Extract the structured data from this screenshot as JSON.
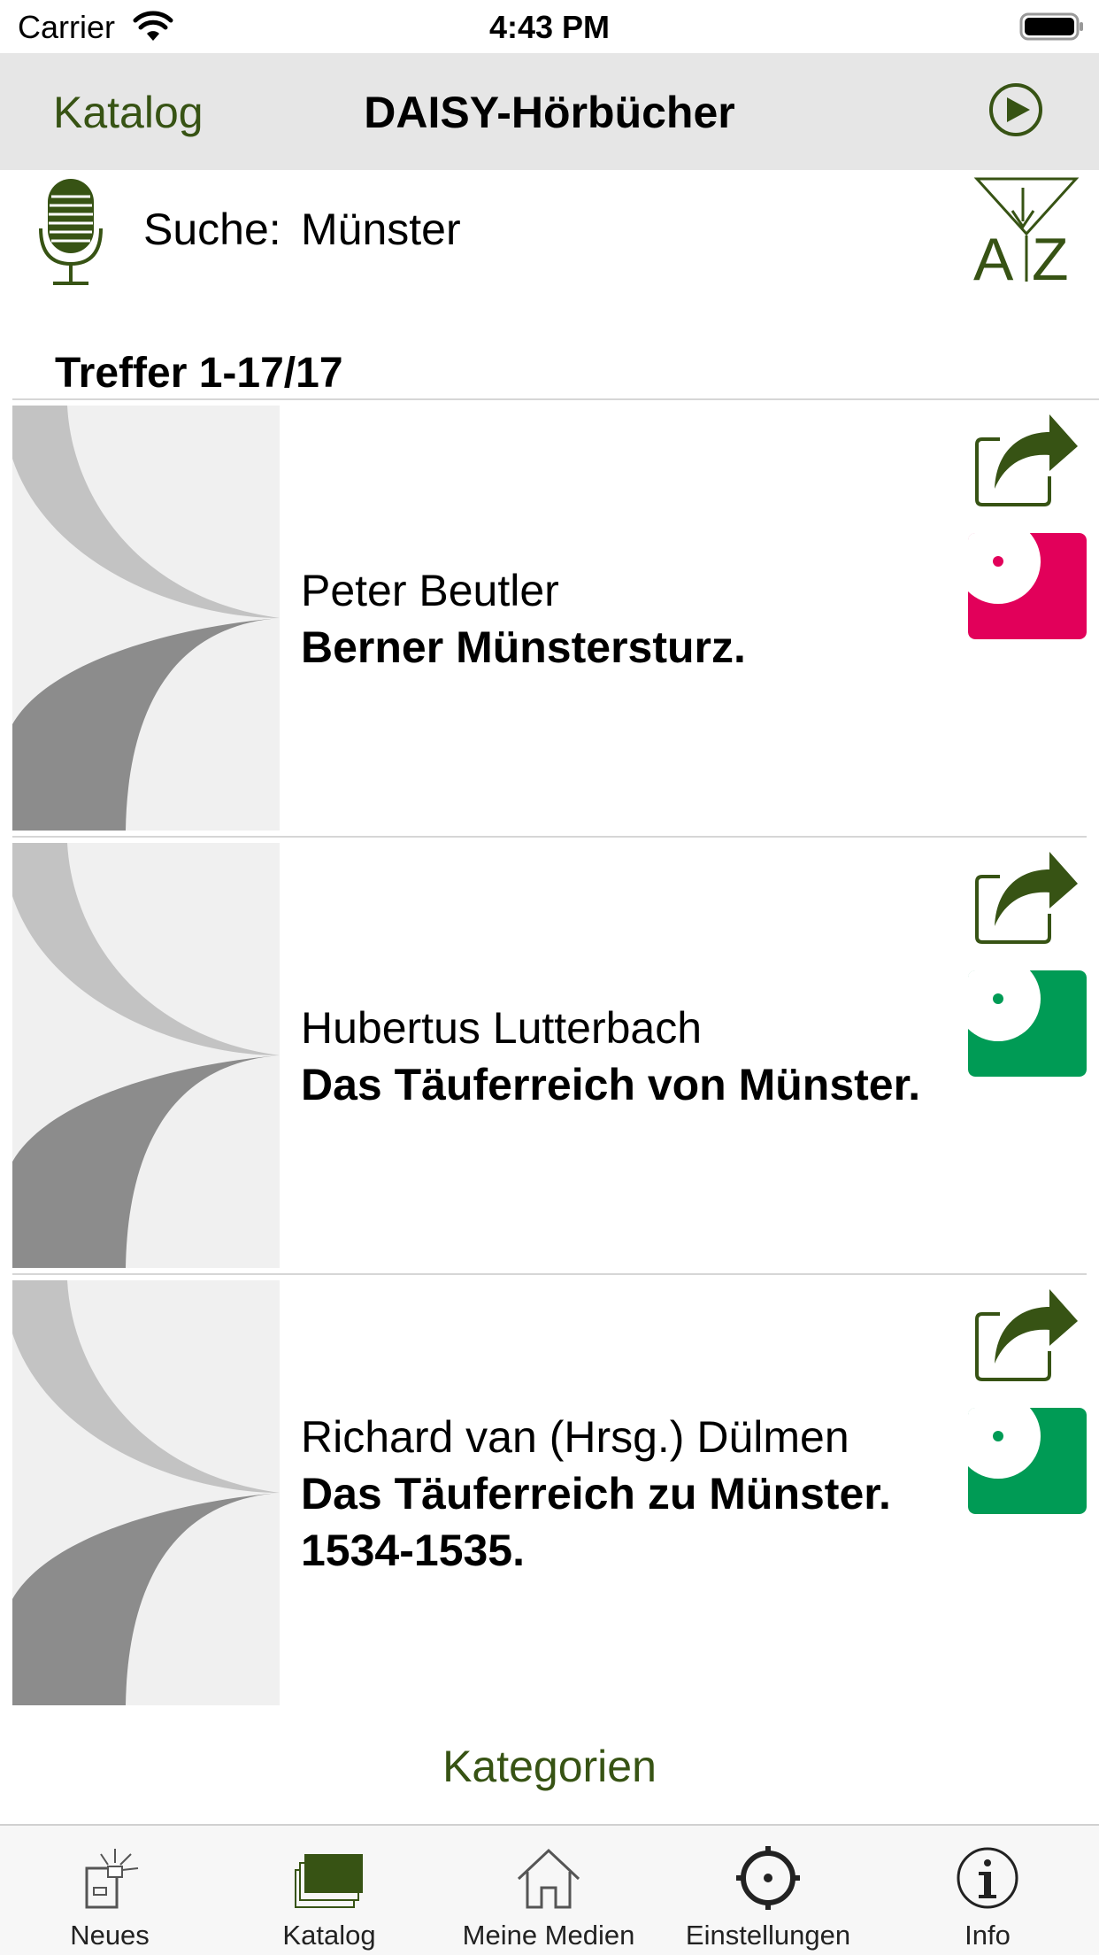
{
  "status_bar": {
    "carrier": "Carrier",
    "time": "4:43 PM"
  },
  "nav": {
    "back_label": "Katalog",
    "title": "DAISY-Hörbücher",
    "play_icon": "play-circle-icon"
  },
  "search": {
    "label": "Suche:",
    "value": "Münster",
    "mic_icon": "microphone-icon",
    "sort_icon": "sort-a-z-icon"
  },
  "results": {
    "hits": "Treffer 1-17/17",
    "items": [
      {
        "author": "Peter Beutler",
        "title": "Berner Münstersturz.",
        "badge_color": "#e2005a"
      },
      {
        "author": "Hubertus Lutterbach",
        "title": "Das Täuferreich von Münster.",
        "badge_color": "#009b55"
      },
      {
        "author": "Richard van (Hrsg.) Dülmen",
        "title": "Das Täuferreich zu Münster. 1534-1535.",
        "badge_color": "#009b55"
      }
    ]
  },
  "footer_link": "Kategorien",
  "tabs": [
    {
      "label": "Neues",
      "icon": "news-icon"
    },
    {
      "label": "Katalog",
      "icon": "catalog-icon"
    },
    {
      "label": "Meine Medien",
      "icon": "home-icon"
    },
    {
      "label": "Einstellungen",
      "icon": "gear-icon"
    },
    {
      "label": "Info",
      "icon": "info-icon"
    }
  ],
  "colors": {
    "accent": "#375314",
    "nav_bg": "#e6e6e6",
    "tab_bg": "#f7f7f7"
  }
}
